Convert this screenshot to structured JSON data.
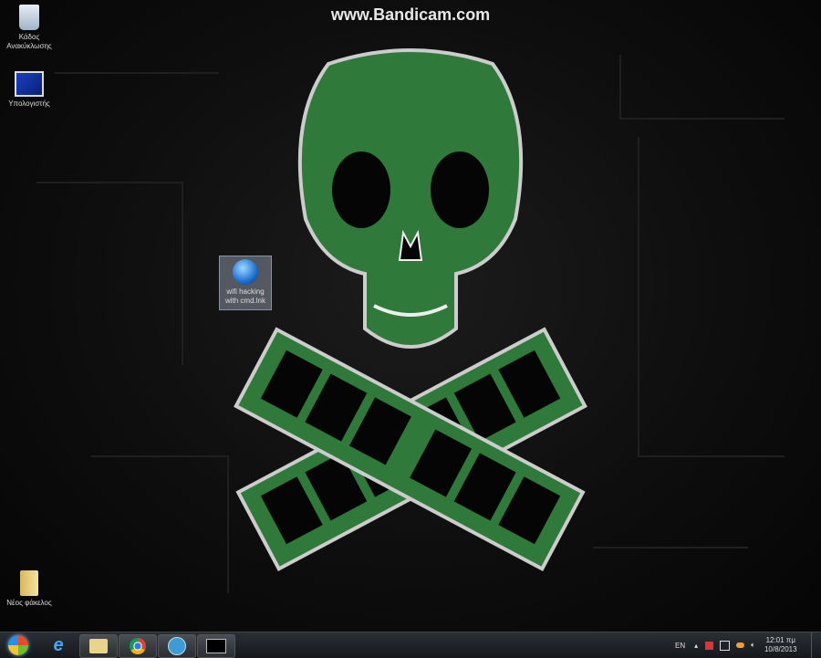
{
  "watermark": "www.Bandicam.com",
  "desktop_icons": [
    {
      "label": "Κάδος Ανακύκλωσης",
      "icon": "recycle-bin-icon"
    },
    {
      "label": "Υπολογιστής",
      "icon": "computer-icon"
    },
    {
      "label": "wifi hacking with cmd.lnk",
      "icon": "shortcut-globe-icon"
    },
    {
      "label": "Νέος φάκελος",
      "icon": "folder-icon"
    }
  ],
  "taskbar": {
    "apps": [
      "start-button",
      "internet-explorer",
      "windows-explorer",
      "google-chrome",
      "app-blue-circle",
      "command-prompt"
    ]
  },
  "tray": {
    "language": "EN",
    "time": "12:01 πμ",
    "date": "10/8/2013"
  },
  "colors": {
    "skull": "#2f7a3a",
    "taskbar": "#1e2227"
  }
}
